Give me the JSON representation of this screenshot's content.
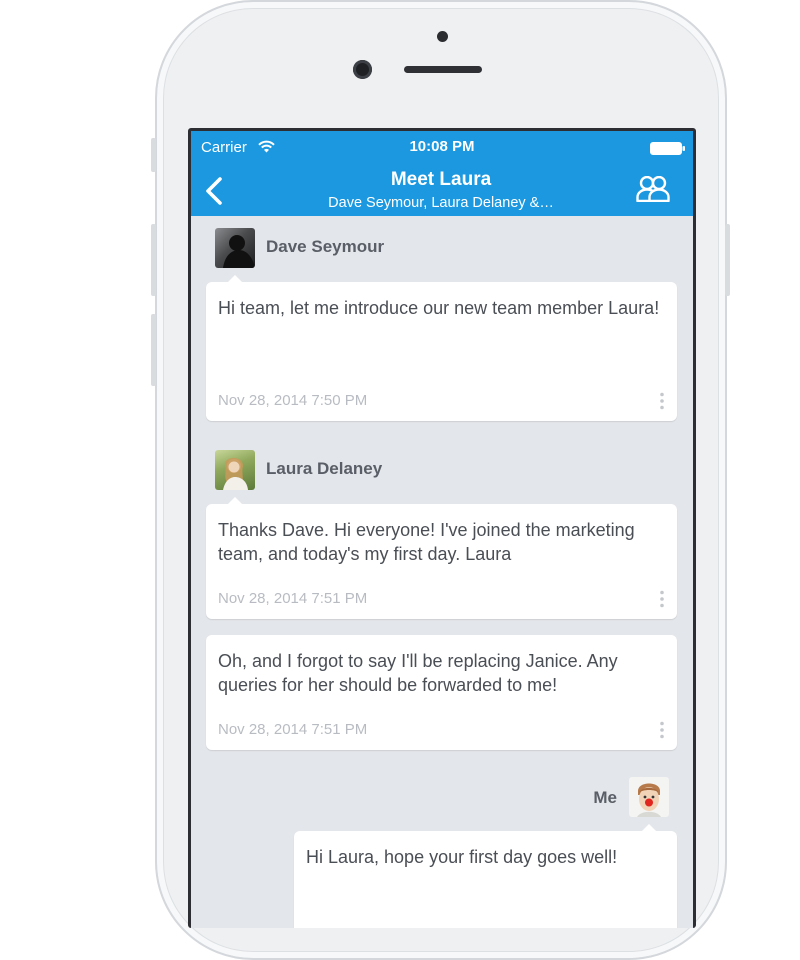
{
  "status_bar": {
    "carrier": "Carrier",
    "time": "10:08 PM"
  },
  "header": {
    "title": "Meet Laura",
    "subtitle": "Dave Seymour, Laura Delaney &…",
    "background_color": "#1b98e0"
  },
  "icons": {
    "back": "chevron-left-icon",
    "participants": "people-icon",
    "wifi": "wifi-icon",
    "battery": "battery-icon",
    "more": "vertical-ellipsis-icon"
  },
  "messages": [
    {
      "sender": "Dave Seymour",
      "text": "Hi team, let me introduce our new team member Laura!",
      "timestamp": "Nov 28, 2014 7:50 PM"
    },
    {
      "sender": "Laura Delaney",
      "text": "Thanks Dave. Hi everyone! I've joined the marketing team, and today's my first day. Laura",
      "timestamp": "Nov 28, 2014 7:51 PM"
    },
    {
      "sender": "Laura Delaney",
      "text": "Oh, and I forgot to say I'll be replacing Janice. Any queries for her should be forwarded to me!",
      "timestamp": "Nov 28, 2014 7:51 PM"
    },
    {
      "sender": "Me",
      "text": "Hi Laura, hope your first day goes well!",
      "timestamp": ""
    }
  ]
}
